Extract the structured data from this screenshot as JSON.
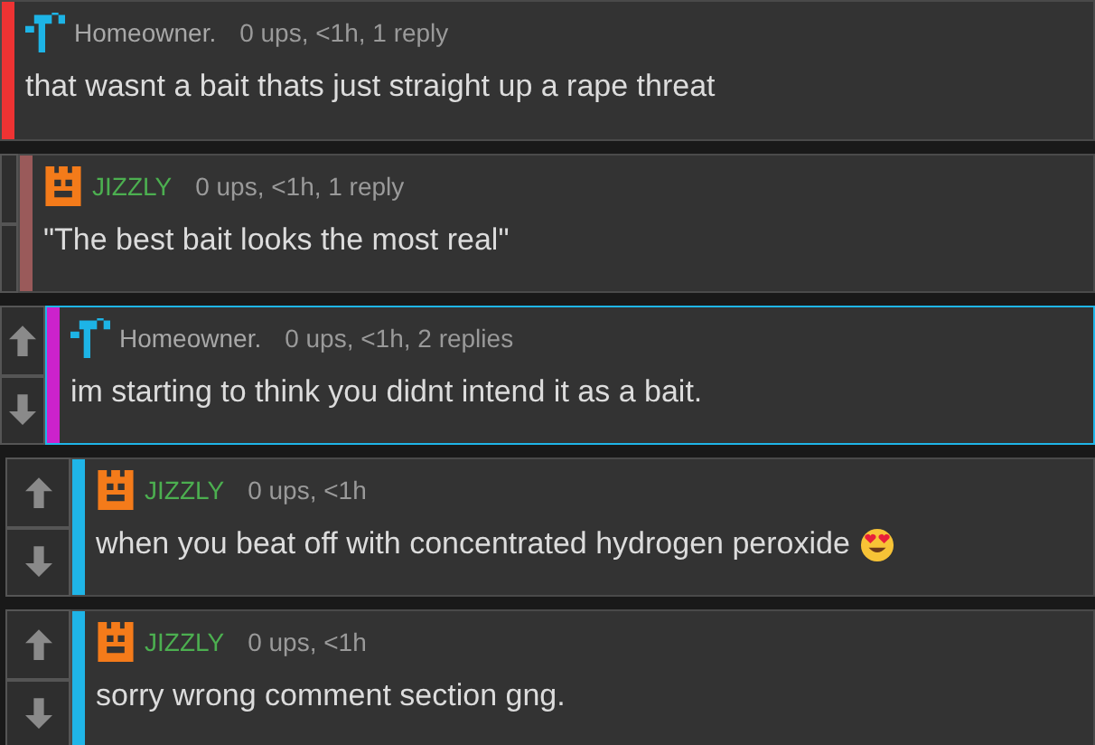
{
  "comments": [
    {
      "kind": "cross",
      "author": "Homeowner.",
      "meta": "0 ups, <1h, 1 reply",
      "text": "that wasnt a bait thats just straight up a rape threat",
      "color": "#ee3333",
      "highlighted": false
    },
    {
      "kind": "castle",
      "author": "JIZZLY",
      "meta": "0 ups, <1h, 1 reply",
      "text": "\"The best bait looks the most real\"",
      "color": "#9a5a5a",
      "highlighted": false
    },
    {
      "kind": "cross",
      "author": "Homeowner.",
      "meta": "0 ups, <1h, 2 replies",
      "text": "im starting to think you didnt intend it as a bait.",
      "color": "#cc22cc",
      "highlighted": true
    },
    {
      "kind": "castle",
      "author": "JIZZLY",
      "meta": "0 ups, <1h",
      "text": "when you beat off with concentrated hydrogen peroxide",
      "emoji": true,
      "color": "#1fb5e8",
      "highlighted": false
    },
    {
      "kind": "castle",
      "author": "JIZZLY",
      "meta": "0 ups, <1h",
      "text": "sorry wrong comment section gng.",
      "color": "#1fb5e8",
      "highlighted": false
    }
  ]
}
